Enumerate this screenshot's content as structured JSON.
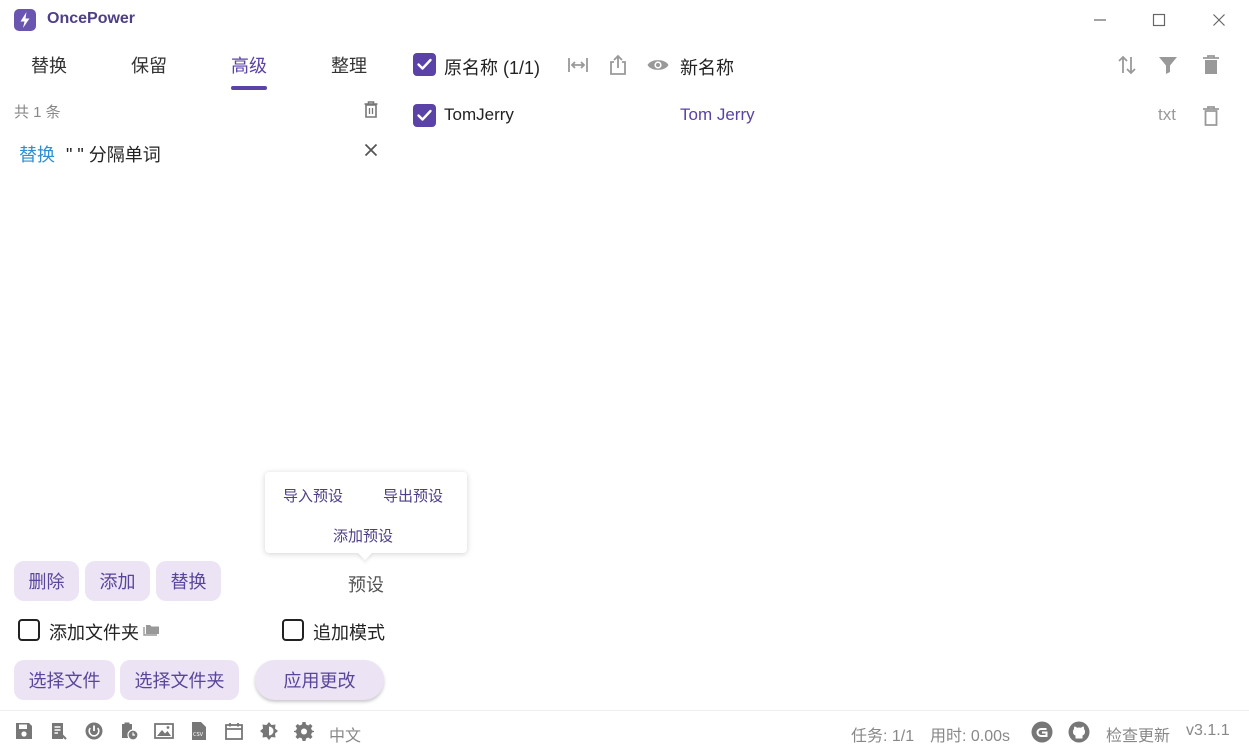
{
  "app": {
    "title": "OncePower"
  },
  "tabs": [
    "替换",
    "保留",
    "高级",
    "整理"
  ],
  "active_tab": "高级",
  "rules": {
    "count_label": "共 1 条",
    "items": [
      {
        "type": "替换",
        "text": "\" \" 分隔单词"
      }
    ]
  },
  "preset_menu": {
    "import": "导入预设",
    "export": "导出预设",
    "add": "添加预设"
  },
  "buttons": {
    "delete": "删除",
    "add": "添加",
    "replace": "替换",
    "preset": "预设",
    "choose_file": "选择文件",
    "choose_folder": "选择文件夹",
    "apply": "应用更改"
  },
  "options": {
    "add_folder": "添加文件夹",
    "add_folder_checked": false,
    "append_mode": "追加模式",
    "append_mode_checked": false
  },
  "list": {
    "header": {
      "original": "原名称 (1/1)",
      "new": "新名称",
      "select_all_checked": true
    },
    "rows": [
      {
        "original": "TomJerry",
        "new": "Tom Jerry",
        "ext": "txt",
        "checked": true
      }
    ]
  },
  "status": {
    "language": "中文",
    "task": "任务: 1/1",
    "time": "用时: 0.00s",
    "update": "检查更新",
    "version": "v3.1.1"
  },
  "colors": {
    "accent": "#5a42a6",
    "button_bg": "#ece3f4",
    "rule_type": "#2f8fd0"
  }
}
